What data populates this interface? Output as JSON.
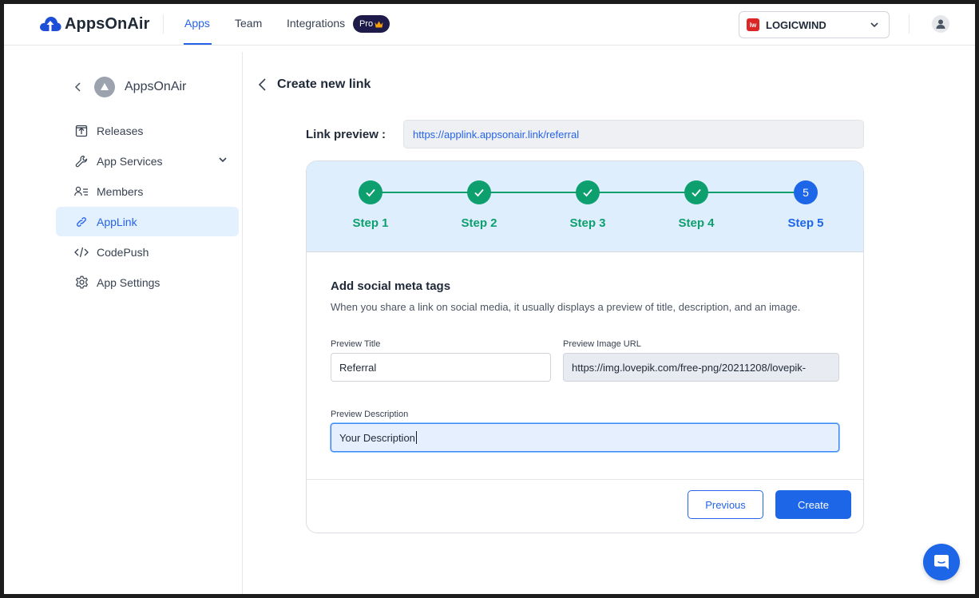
{
  "header": {
    "brand": "AppsOnAir",
    "nav": [
      {
        "label": "Apps",
        "active": true
      },
      {
        "label": "Team",
        "active": false
      },
      {
        "label": "Integrations",
        "active": false
      }
    ],
    "pro_badge": "Pro",
    "org_name": "LOGICWIND",
    "org_logo_text": "lw",
    "accent_color": "#2563eb"
  },
  "sidebar": {
    "app_name": "AppsOnAir",
    "items": [
      {
        "label": "Releases",
        "icon": "upload-box-icon",
        "active": false
      },
      {
        "label": "App Services",
        "icon": "wrench-icon",
        "active": false,
        "expandable": true
      },
      {
        "label": "Members",
        "icon": "members-icon",
        "active": false
      },
      {
        "label": "AppLink",
        "icon": "link-icon",
        "active": true
      },
      {
        "label": "CodePush",
        "icon": "code-icon",
        "active": false
      },
      {
        "label": "App Settings",
        "icon": "gear-icon",
        "active": false
      }
    ]
  },
  "main": {
    "title": "Create new link",
    "link_preview_label": "Link preview :",
    "link_preview_value": "https://applink.appsonair.link/referral",
    "steps": [
      {
        "label": "Step 1",
        "status": "done"
      },
      {
        "label": "Step 2",
        "status": "done"
      },
      {
        "label": "Step 3",
        "status": "done"
      },
      {
        "label": "Step 4",
        "status": "done"
      },
      {
        "label": "Step 5",
        "status": "current",
        "number": "5"
      }
    ],
    "section_title": "Add social meta tags",
    "section_desc": "When you share a link on social media, it usually displays a preview of title, description, and an image.",
    "fields": {
      "preview_title_label": "Preview Title",
      "preview_title_value": "Referral",
      "preview_image_label": "Preview Image URL",
      "preview_image_value": "https://img.lovepik.com/free-png/20211208/lovepik-",
      "preview_desc_label": "Preview Description",
      "preview_desc_value": "Your Description"
    },
    "buttons": {
      "previous": "Previous",
      "create": "Create"
    }
  },
  "colors": {
    "success": "#0e9f6e",
    "primary": "#1d66e8",
    "stepper_bg": "#dfeefd"
  }
}
